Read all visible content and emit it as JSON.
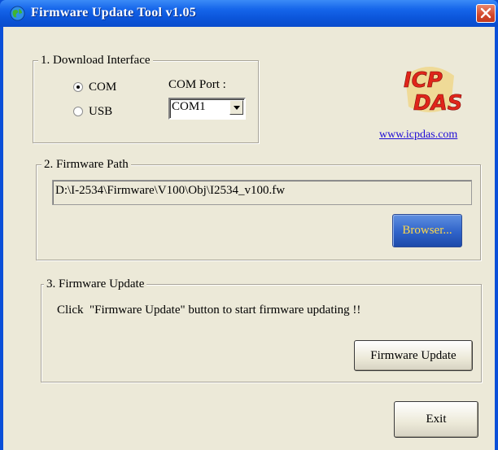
{
  "window": {
    "title": "Firmware Update Tool v1.05"
  },
  "download_interface": {
    "legend": "1. Download Interface",
    "options": [
      {
        "label": "COM",
        "selected": true
      },
      {
        "label": "USB",
        "selected": false
      }
    ],
    "com_port_label": "COM Port :",
    "com_port_value": "COM1"
  },
  "branding": {
    "logo_text_top": "ICP",
    "logo_text_bottom": "DAS",
    "website": "www.icpdas.com"
  },
  "firmware_path": {
    "legend": "2. Firmware Path",
    "path_value": "D:\\I-2534\\Firmware\\V100\\Obj\\I2534_v100.fw",
    "browse_label": "Browser..."
  },
  "firmware_update": {
    "legend": "3. Firmware Update",
    "instruction": "Click  \"Firmware Update\" button to start firmware updating !!",
    "update_button_label": "Firmware Update"
  },
  "exit_label": "Exit",
  "colors": {
    "title_bar": "#0b54d9",
    "dialog_bg": "#ece9d8",
    "close_button": "#d2472a",
    "browse_text": "#ffd84a",
    "link": "#1d0bd6"
  }
}
